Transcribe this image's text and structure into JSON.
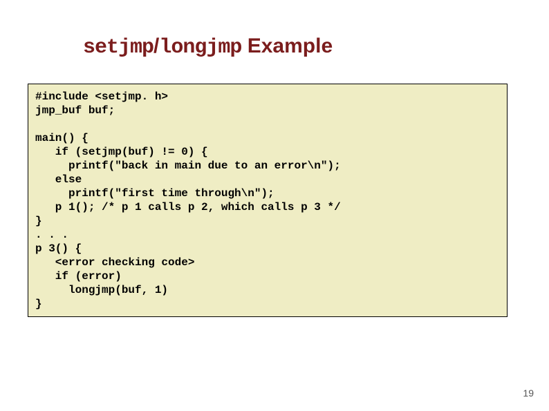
{
  "title": {
    "part1_mono": "setjmp",
    "sep": "/",
    "part2_mono": "longjmp",
    "suffix": " Example"
  },
  "code": "#include <setjmp. h>\njmp_buf buf;\n\nmain() {\n   if (setjmp(buf) != 0) {\n     printf(\"back in main due to an error\\n\");\n   else\n     printf(\"first time through\\n\");\n   p 1(); /* p 1 calls p 2, which calls p 3 */\n}\n. . . \np 3() {\n   <error checking code>\n   if (error)\n     longjmp(buf, 1)\n}",
  "page_number": "19"
}
